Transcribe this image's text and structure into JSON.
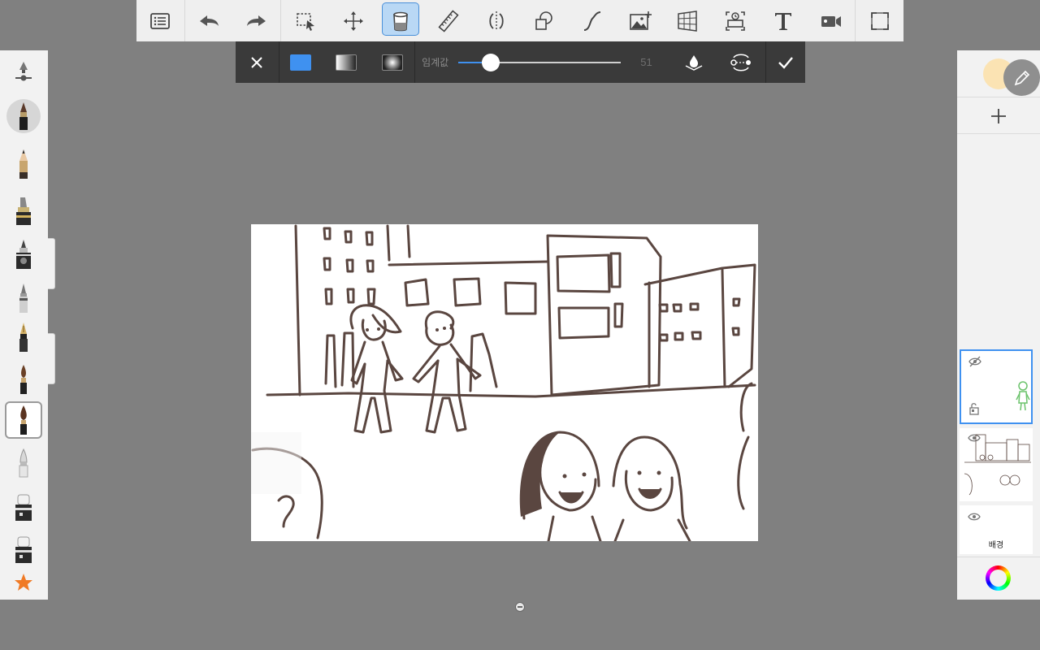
{
  "toolbar": {
    "items": [
      {
        "icon": "list-icon",
        "name": "menu"
      },
      {
        "icon": "undo-icon",
        "name": "undo"
      },
      {
        "icon": "redo-icon",
        "name": "redo"
      },
      {
        "icon": "selection-icon",
        "name": "selection"
      },
      {
        "icon": "transform-icon",
        "name": "transform"
      },
      {
        "icon": "fill-bucket-icon",
        "name": "fill",
        "active": true
      },
      {
        "icon": "ruler-icon",
        "name": "ruler"
      },
      {
        "icon": "symmetry-icon",
        "name": "symmetry"
      },
      {
        "icon": "shapes-icon",
        "name": "shapes"
      },
      {
        "icon": "stroke-icon",
        "name": "predictive-stroke"
      },
      {
        "icon": "add-image-icon",
        "name": "add-image"
      },
      {
        "icon": "perspective-icon",
        "name": "perspective"
      },
      {
        "icon": "time-lapse-icon",
        "name": "time-lapse"
      },
      {
        "icon": "text-icon",
        "name": "text"
      },
      {
        "icon": "video-icon",
        "name": "record"
      },
      {
        "icon": "fullscreen-icon",
        "name": "fullscreen"
      }
    ]
  },
  "fill_bar": {
    "threshold_label": "임계값",
    "threshold_value": "51",
    "threshold_fraction": 0.2,
    "fill_modes": [
      "solid",
      "linear-gradient",
      "radial-gradient"
    ],
    "selected_mode": "solid",
    "solid_color": "#3f91f0"
  },
  "layers": {
    "background_name": "배경",
    "active_layer": 0
  },
  "colors": {
    "accent": "#3f91f0",
    "current_color": "#fbe3b3",
    "ink": "#5a4640"
  }
}
